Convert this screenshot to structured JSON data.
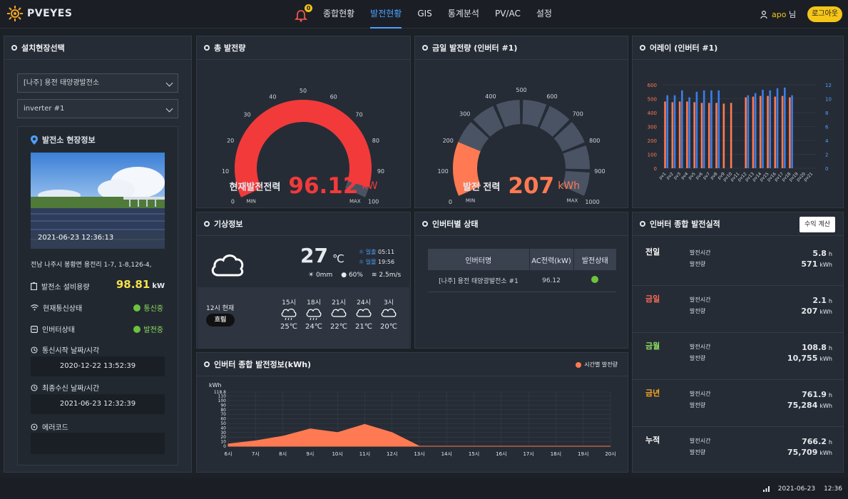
{
  "app": {
    "title": "PVEYES",
    "user": "apo",
    "user_suffix": "님",
    "logout": "로그아웃",
    "notice_count": "0"
  },
  "nav": [
    "종합현황",
    "발전현황",
    "GIS",
    "통계분석",
    "PV/AC",
    "설정"
  ],
  "site": {
    "header": "설치현장선택",
    "select_site": "[나주] 용전 태양광발전소",
    "select_inverter": "inverter #1",
    "info_title": "발전소 현장정보",
    "photo_time": "2021-06-23 12:36:13",
    "address": "전남 나주시 봉황면 용전리 1-7, 1-8,126-4,",
    "capacity_label": "발전소 설비용량",
    "capacity_value": "98.81",
    "capacity_unit": "kW",
    "comm_label": "현재통신상태",
    "comm_value": "통신중",
    "inv_label": "인버터상태",
    "inv_value": "발전중",
    "start_label": "통신시작 날짜/시각",
    "start_value": "2020-12-22 13:52:39",
    "last_label": "최종수신 날짜/시간",
    "last_value": "2021-06-23 12:32:39",
    "err_label": "에러코드",
    "err_value": ""
  },
  "total": {
    "header": "총 발전량",
    "label": "현재발전전력",
    "value": "96.12",
    "unit": "kW",
    "min": "MIN",
    "max": "MAX",
    "ticks": [
      "0",
      "10",
      "20",
      "30",
      "40",
      "50",
      "60",
      "70",
      "80",
      "90",
      "100"
    ],
    "fraction": 0.9612
  },
  "today": {
    "header": "금일 발전량 (인버터 #1)",
    "label": "발전 전력",
    "value": "207",
    "unit": "kWh",
    "min": "MIN",
    "max": "MAX",
    "ticks": [
      "0",
      "100",
      "200",
      "300",
      "400",
      "500",
      "600",
      "700",
      "800",
      "900",
      "1000"
    ],
    "fraction": 0.207
  },
  "array": {
    "header": "어레이 (인버터 #1)"
  },
  "weather": {
    "header": "기상정보",
    "temp": "27",
    "temp_unit": "℃",
    "sunrise_label": "일출",
    "sunrise": "05:11",
    "sunset_label": "일몰",
    "sunset": "19:56",
    "rain": "0mm",
    "humidity": "60%",
    "wind": "2.5m/s",
    "now": "12시 현재",
    "now_state": "흐림",
    "forecast": [
      {
        "time": "15시",
        "temp": "25℃"
      },
      {
        "time": "18시",
        "temp": "24℃"
      },
      {
        "time": "21시",
        "temp": "22℃"
      },
      {
        "time": "24시",
        "temp": "21℃"
      },
      {
        "time": "3시",
        "temp": "20℃"
      }
    ]
  },
  "inverters": {
    "header": "인버터별 상태",
    "cols": [
      "인버터명",
      "AC전력(kW)",
      "발전상태"
    ],
    "row": {
      "name": "[나주] 용전 태양광발전소 #1",
      "power": "96.12"
    }
  },
  "summary": {
    "header": "인버터 종합 발전실적",
    "button": "수익 계산",
    "time_label": "발전시간",
    "energy_label": "발전량",
    "h": "h",
    "kwh": "kWh",
    "rows": [
      {
        "k": "전일",
        "time": "5.8",
        "energy": "571",
        "color": "#ffffff"
      },
      {
        "k": "금일",
        "time": "2.1",
        "energy": "207",
        "color": "#ff6b5a"
      },
      {
        "k": "금월",
        "time": "108.8",
        "energy": "10,755",
        "color": "#8fe060"
      },
      {
        "k": "금년",
        "time": "761.9",
        "energy": "75,284",
        "color": "#f5a623"
      },
      {
        "k": "누적",
        "time": "766.2",
        "energy": "75,709",
        "color": "#ffffff"
      }
    ]
  },
  "footer": {
    "date": "2021-06-23",
    "time": "12:36"
  },
  "colors": {
    "accent": "#4ea0ff",
    "red": "#f23a3a",
    "orange": "#ff7a52",
    "yellow": "#f5c518",
    "green": "#6cc33e"
  },
  "chart_data": [
    {
      "type": "bar",
      "title": "어레이 (인버터 #1)",
      "categories": [
        "pv1",
        "pv2",
        "pv3",
        "pv4",
        "pv5",
        "pv6",
        "pv7",
        "pv8",
        "pv9",
        "pv10",
        "pv11",
        "pv12",
        "pv13",
        "pv14",
        "pv15",
        "pv16",
        "pv17",
        "pv18",
        "pv19",
        "pv20",
        "pv21"
      ],
      "ylim_left": [
        0,
        600
      ],
      "ylim_right": [
        0,
        12
      ],
      "left_ticks": [
        "0",
        "100",
        "200",
        "300",
        "400",
        "500",
        "600"
      ],
      "right_ticks": [
        "0",
        "2",
        "4",
        "6",
        "8",
        "10",
        "12"
      ],
      "series": [
        {
          "axis": "left",
          "values": [
            480,
            475,
            480,
            480,
            475,
            470,
            470,
            470,
            465,
            470,
            0,
            510,
            515,
            520,
            520,
            515,
            520,
            510,
            0,
            0,
            0
          ]
        },
        {
          "axis": "right",
          "values": [
            10.5,
            10.5,
            11.2,
            10.2,
            11,
            11.2,
            11.2,
            11.2,
            0,
            0,
            0,
            10.5,
            10.8,
            11.3,
            11.2,
            11.5,
            11.6,
            10.5,
            0,
            0,
            0
          ]
        }
      ]
    },
    {
      "type": "area",
      "title": "인버터 종합 발전정보(kWh)",
      "legend": "시간별 발전량",
      "ylabel": "kWh",
      "x": [
        "6시",
        "7시",
        "8시",
        "9시",
        "10시",
        "11시",
        "12시",
        "13시",
        "14시",
        "15시",
        "16시",
        "17시",
        "18시",
        "19시",
        "20시"
      ],
      "y_ticks": [
        "0",
        "10",
        "20",
        "30",
        "40",
        "50",
        "60",
        "70",
        "80",
        "90",
        "100",
        "110",
        "118.8"
      ],
      "ylim": [
        0,
        118.8
      ],
      "values": [
        5,
        12,
        22,
        38,
        30,
        48,
        30,
        0,
        0,
        0,
        0,
        0,
        0,
        0,
        0
      ]
    }
  ]
}
